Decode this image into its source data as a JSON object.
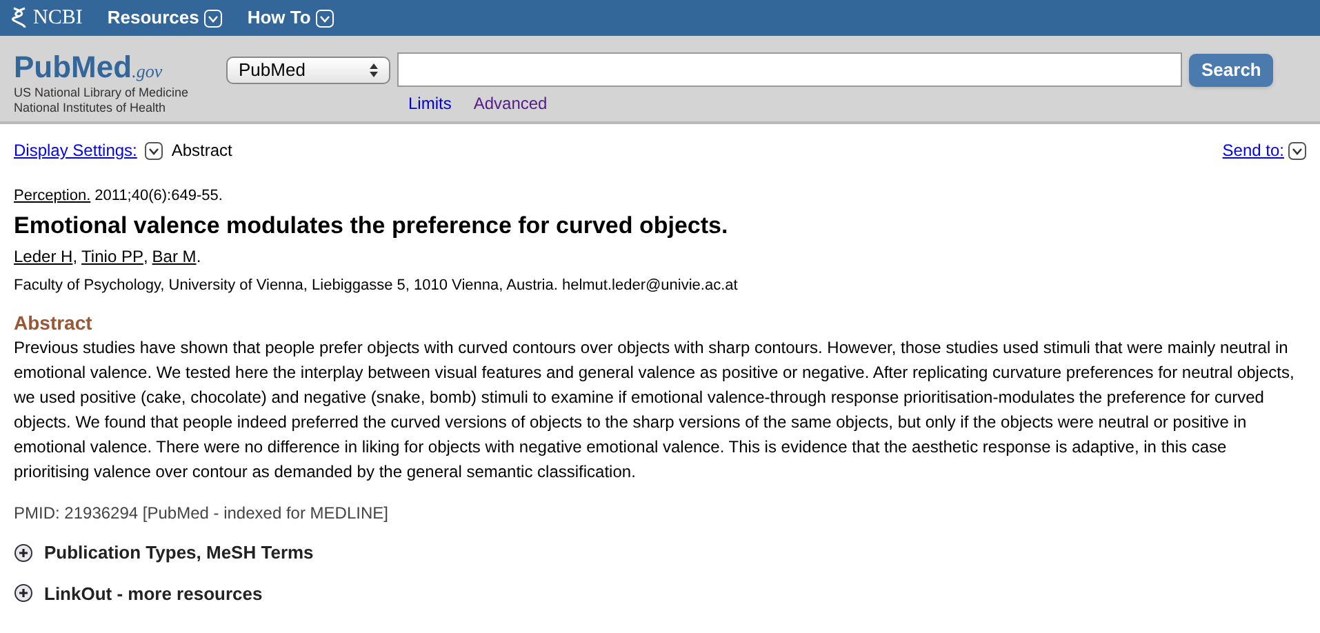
{
  "top_bar": {
    "brand": "NCBI",
    "menus": [
      "Resources",
      "How To"
    ]
  },
  "header": {
    "logo": {
      "name": "PubMed",
      "suffix": ".gov"
    },
    "org_lines": [
      "US National Library of Medicine",
      "National Institutes of Health"
    ],
    "database_select": "PubMed",
    "search_button": "Search",
    "links": [
      "Limits",
      "Advanced"
    ]
  },
  "toolbar": {
    "display_settings": "Display Settings:",
    "format": "Abstract",
    "send_to": "Send to:"
  },
  "article": {
    "journal": "Perception.",
    "citation": "2011;40(6):649-55.",
    "title": "Emotional valence modulates the preference for curved objects.",
    "authors": [
      {
        "name": "Leder H",
        "punct": ","
      },
      {
        "name": "Tinio PP",
        "punct": ","
      },
      {
        "name": "Bar M",
        "punct": "."
      }
    ],
    "affiliation": "Faculty of Psychology, University of Vienna, Liebiggasse 5, 1010 Vienna, Austria. helmut.leder@univie.ac.at",
    "abstract_heading": "Abstract",
    "abstract": "Previous studies have shown that people prefer objects with curved contours over objects with sharp contours. However, those studies used stimuli that were mainly neutral in emotional valence. We tested here the interplay between visual features and general valence as positive or negative. After replicating curvature preferences for neutral objects, we used positive (cake, chocolate) and negative (snake, bomb) stimuli to examine if emotional valence-through response prioritisation-modulates the preference for curved objects. We found that people indeed preferred the curved versions of objects to the sharp versions of the same objects, but only if the objects were neutral or positive in emotional valence. There were no difference in liking for objects with negative emotional valence. This is evidence that the aesthetic response is adaptive, in this case prioritising valence over contour as demanded by the general semantic classification.",
    "pmid": "PMID: 21936294 [PubMed - indexed for MEDLINE]"
  },
  "sections": [
    {
      "label": "Publication Types, MeSH Terms",
      "expanded": false
    },
    {
      "label": "LinkOut - more resources",
      "expanded": false
    }
  ]
}
